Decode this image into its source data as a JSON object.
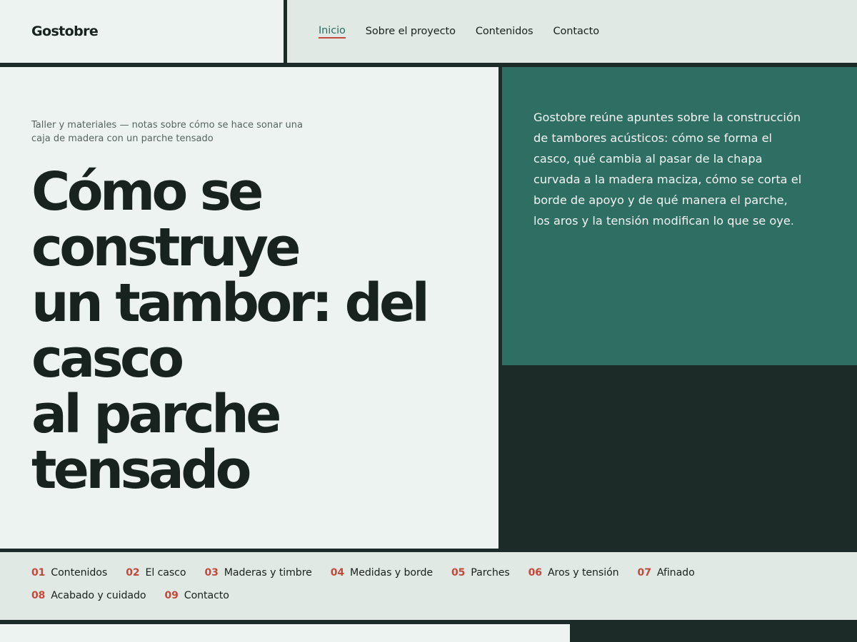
{
  "header": {
    "brand": "Gostobre",
    "nav": [
      {
        "label": "Inicio",
        "active": true
      },
      {
        "label": "Sobre el proyecto",
        "active": false
      },
      {
        "label": "Contenidos",
        "active": false
      },
      {
        "label": "Contacto",
        "active": false
      }
    ]
  },
  "hero": {
    "eyebrow": "Taller y materiales — notas sobre cómo se hace sonar una caja de madera con un parche tensado",
    "title_lines": [
      "Cómo se",
      "construye",
      "un tambor: del",
      "casco",
      "al parche",
      "tensado"
    ],
    "intro": "Gostobre reúne apuntes sobre la construcción de tambores acústicos: cómo se forma el casco, qué cambia al pasar de la chapa curvada a la madera maciza, cómo se corta el borde de apoyo y de qué manera el parche, los aros y la tensión modifican lo que se oye."
  },
  "chapters": [
    {
      "num": "01",
      "label": "Contenidos"
    },
    {
      "num": "02",
      "label": "El casco"
    },
    {
      "num": "03",
      "label": "Maderas y timbre"
    },
    {
      "num": "04",
      "label": "Medidas y borde"
    },
    {
      "num": "05",
      "label": "Parches"
    },
    {
      "num": "06",
      "label": "Aros y tensión"
    },
    {
      "num": "07",
      "label": "Afinado"
    },
    {
      "num": "08",
      "label": "Acabado y cuidado"
    },
    {
      "num": "09",
      "label": "Contacto"
    }
  ],
  "colors": {
    "accent_green": "#2e6e63",
    "accent_red": "#c4493b",
    "dark": "#1c2a28",
    "light": "#edf3f0"
  }
}
